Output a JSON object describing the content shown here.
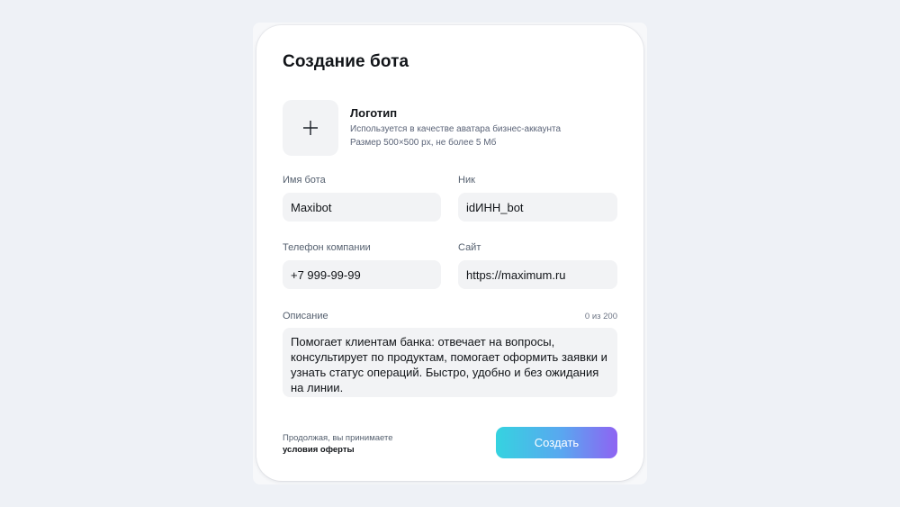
{
  "form": {
    "title": "Создание бота",
    "logo": {
      "title": "Логотип",
      "hint_line1": "Используется в качестве аватара бизнес-аккаунта",
      "hint_line2": "Размер 500×500 px, не более 5 Мб",
      "icon": "plus-icon"
    },
    "fields": {
      "bot_name": {
        "label": "Имя бота",
        "value": "Maxibot"
      },
      "nick": {
        "label": "Ник",
        "value": "idИНН_bot"
      },
      "phone": {
        "label": "Телефон компании",
        "value": "+7 999-99-99"
      },
      "site": {
        "label": "Сайт",
        "value": "https://maximum.ru"
      }
    },
    "description": {
      "label": "Описание",
      "counter": "0 из 200",
      "value": "Помогает клиентам банка: отвечает на вопросы, консультирует по продуктам, помогает оформить заявки и узнать статус операций. Быстро, удобно и без ожидания на линии."
    },
    "footer": {
      "terms_prefix": "Продолжая, вы принимаете",
      "terms_link": "условия оферты",
      "create_label": "Создать"
    }
  },
  "colors": {
    "background": "#eef1f6",
    "card": "#ffffff",
    "field": "#f2f3f5",
    "button_gradient_start": "#35d3e0",
    "button_gradient_end": "#8e63f2"
  }
}
